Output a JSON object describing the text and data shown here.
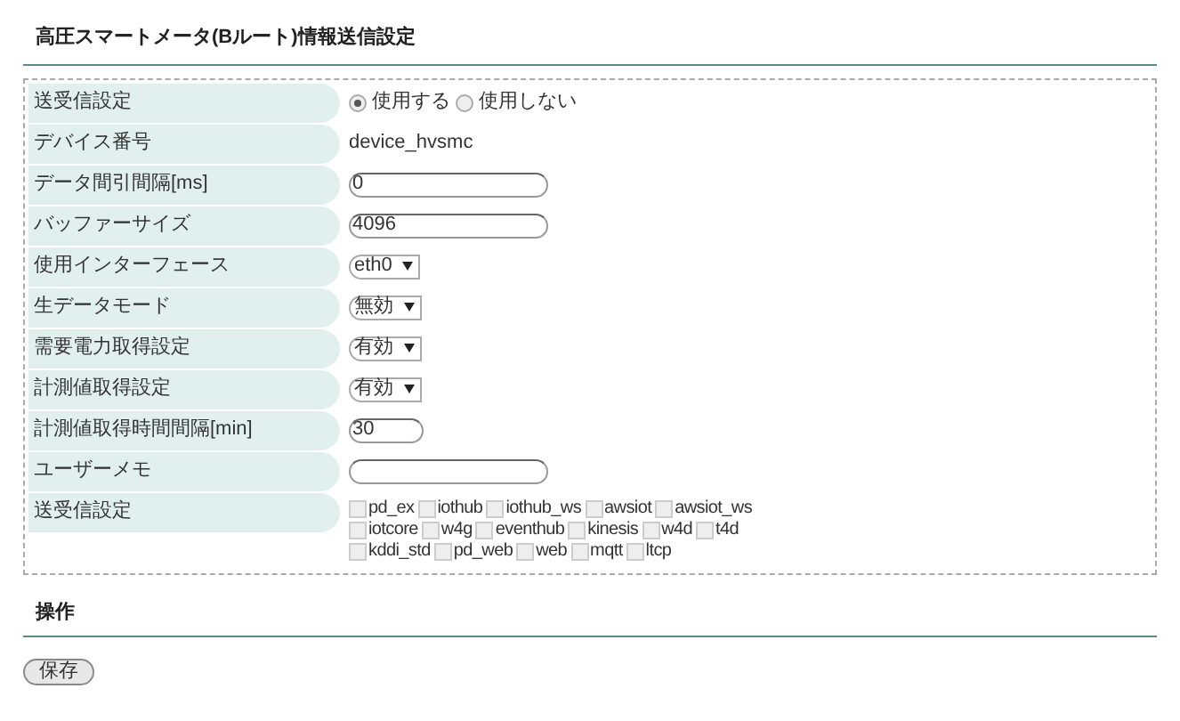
{
  "title": "高圧スマートメータ(Bルート)情報送信設定",
  "rows": [
    {
      "label": "送受信設定",
      "kind": "radio",
      "options": [
        {
          "label": "使用する",
          "selected": true
        },
        {
          "label": "使用しない",
          "selected": false
        }
      ]
    },
    {
      "label": "デバイス番号",
      "kind": "text",
      "value": "device_hvsmc"
    },
    {
      "label": "データ間引間隔[ms]",
      "kind": "input",
      "value": "0"
    },
    {
      "label": "バッファーサイズ",
      "kind": "input",
      "value": "4096"
    },
    {
      "label": "使用インターフェース",
      "kind": "select",
      "value": "eth0"
    },
    {
      "label": "生データモード",
      "kind": "select",
      "value": "無効"
    },
    {
      "label": "需要電力取得設定",
      "kind": "select",
      "value": "有効"
    },
    {
      "label": "計測値取得設定",
      "kind": "select",
      "value": "有効"
    },
    {
      "label": "計測値取得時間間隔[min]",
      "kind": "short_input",
      "value": "30"
    },
    {
      "label": "ユーザーメモ",
      "kind": "input",
      "value": ""
    },
    {
      "label": "送受信設定",
      "kind": "checkboxes",
      "options": [
        {
          "label": "pd_ex",
          "checked": false
        },
        {
          "label": "iothub",
          "checked": false
        },
        {
          "label": "iothub_ws",
          "checked": false
        },
        {
          "label": "awsiot",
          "checked": false
        },
        {
          "label": "awsiot_ws",
          "checked": false
        },
        {
          "label": "iotcore",
          "checked": false
        },
        {
          "label": "w4g",
          "checked": false
        },
        {
          "label": "eventhub",
          "checked": false
        },
        {
          "label": "kinesis",
          "checked": false
        },
        {
          "label": "w4d",
          "checked": false
        },
        {
          "label": "t4d",
          "checked": false
        },
        {
          "label": "kddi_std",
          "checked": false
        },
        {
          "label": "pd_web",
          "checked": false
        },
        {
          "label": "web",
          "checked": false
        },
        {
          "label": "mqtt",
          "checked": false
        },
        {
          "label": "ltcp",
          "checked": false
        }
      ]
    }
  ],
  "operations": {
    "title": "操作",
    "button": "保存"
  }
}
